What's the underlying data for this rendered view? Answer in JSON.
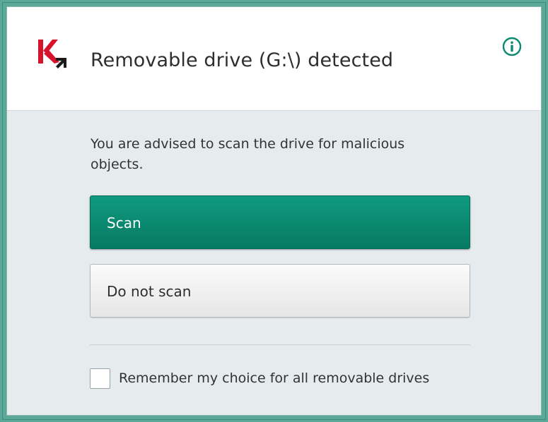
{
  "dialog": {
    "title": "Removable drive  (G:\\) detected",
    "message": "You are advised to scan the drive for malicious objects.",
    "scan_label": "Scan",
    "do_not_scan_label": "Do not scan",
    "remember_label": "Remember my choice for all removable drives",
    "remember_checked": false
  },
  "icons": {
    "logo": "kaspersky-k-logo",
    "info": "info-icon"
  },
  "colors": {
    "frame": "#5aa897",
    "accent": "#0a8a70",
    "logo_red": "#d7132c",
    "background": "#e6ebed"
  }
}
